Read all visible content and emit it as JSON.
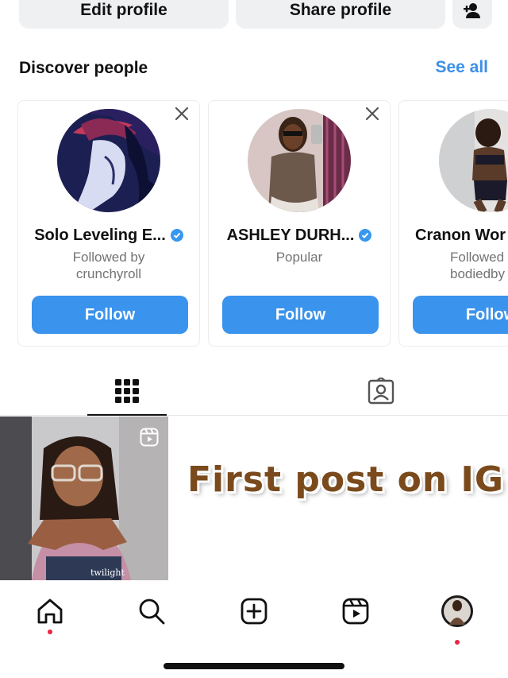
{
  "profile_actions": {
    "edit_label": "Edit profile",
    "share_label": "Share profile"
  },
  "discover": {
    "title": "Discover people",
    "see_all": "See all",
    "cards": [
      {
        "name": "Solo Leveling E...",
        "verified": true,
        "sub_line1": "Followed by",
        "sub_line2": "crunchyroll",
        "follow_label": "Follow"
      },
      {
        "name": "ASHLEY DURH...",
        "verified": true,
        "sub_line1": "Popular",
        "sub_line2": "",
        "follow_label": "Follow"
      },
      {
        "name": "Cranon Wor",
        "verified": false,
        "sub_line1": "Followed",
        "sub_line2": "bodiedby",
        "follow_label": "Follow"
      }
    ]
  },
  "posts": {
    "first_caption": "First post on IG",
    "thumb_caption": "twilight"
  },
  "colors": {
    "accent": "#3a93ec",
    "link": "#3b8fe6",
    "notification_dot": "#ee2245"
  },
  "icons": [
    "add-user-icon",
    "close-icon",
    "verified-icon",
    "grid-icon",
    "tagged-icon",
    "reel-icon",
    "home-icon",
    "search-icon",
    "create-icon",
    "reels-icon"
  ]
}
